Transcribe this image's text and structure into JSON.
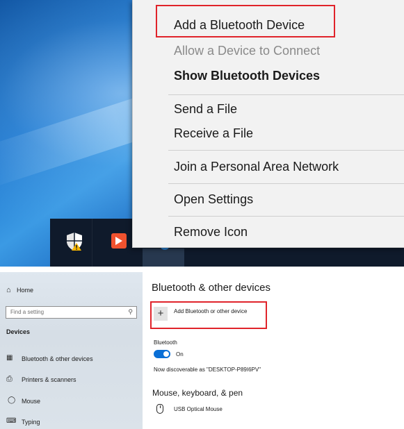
{
  "context_menu": {
    "items": [
      {
        "label": "Add a Bluetooth Device",
        "state": "enabled",
        "highlighted": true
      },
      {
        "label": "Allow a Device to Connect",
        "state": "disabled"
      },
      {
        "label": "Show Bluetooth Devices",
        "state": "default"
      },
      {
        "label": "Send a File",
        "state": "enabled"
      },
      {
        "label": "Receive a File",
        "state": "enabled"
      },
      {
        "label": "Join a Personal Area Network",
        "state": "enabled"
      },
      {
        "label": "Open Settings",
        "state": "enabled"
      },
      {
        "label": "Remove Icon",
        "state": "enabled"
      }
    ]
  },
  "taskbar": {
    "icons": [
      "security-shield-icon",
      "remote-app-icon",
      "bluetooth-tray-icon",
      "tray-app-icon"
    ]
  },
  "settings": {
    "sidebar": {
      "home_label": "Home",
      "search_placeholder": "Find a setting",
      "section_title": "Devices",
      "items": [
        {
          "label": "Bluetooth & other devices",
          "icon": "bluetooth-devices-icon"
        },
        {
          "label": "Printers & scanners",
          "icon": "printer-icon"
        },
        {
          "label": "Mouse",
          "icon": "mouse-icon"
        },
        {
          "label": "Typing",
          "icon": "keyboard-icon"
        }
      ]
    },
    "main": {
      "title": "Bluetooth & other devices",
      "add_device_label": "Add Bluetooth or other device",
      "bluetooth_heading": "Bluetooth",
      "bluetooth_state": "On",
      "bluetooth_on": true,
      "discoverable_text": "Now discoverable as \"DESKTOP-P89I6PV\"",
      "mouse_section_heading": "Mouse, keyboard, & pen",
      "devices": [
        {
          "name": "USB Optical Mouse",
          "icon": "mouse-icon"
        }
      ]
    }
  },
  "colors": {
    "highlight_box": "#e0232a",
    "toggle_on": "#0a6fd6",
    "menu_background": "#f2f2f2"
  }
}
